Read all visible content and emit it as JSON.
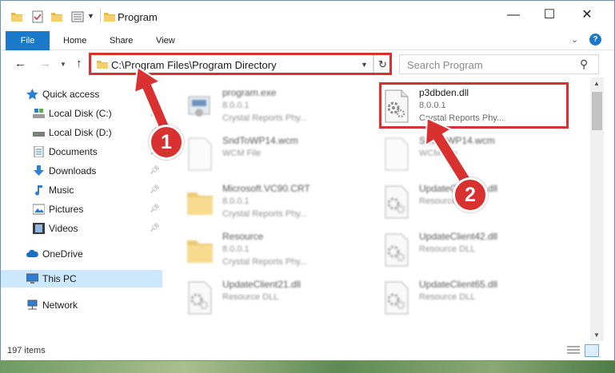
{
  "window": {
    "title": "Program",
    "controls": {
      "minimize": "—",
      "maximize": "☐",
      "close": "✕"
    }
  },
  "ribbon": {
    "tabs": [
      {
        "label": "File"
      },
      {
        "label": "Home"
      },
      {
        "label": "Share"
      },
      {
        "label": "View"
      }
    ],
    "help": "?"
  },
  "navigation": {
    "back": "←",
    "forward": "→",
    "history": "⌄",
    "up": "↑",
    "address": "C:\\Program Files\\Program Directory",
    "refresh": "↻",
    "search_placeholder": "Search Program"
  },
  "sidebar": {
    "items": [
      {
        "label": "Quick access",
        "icon": "star-icon"
      },
      {
        "label": "Local Disk (C:)",
        "icon": "drive-c-icon",
        "pinned": true
      },
      {
        "label": "Local Disk (D:)",
        "icon": "drive-icon",
        "pinned": true
      },
      {
        "label": "Documents",
        "icon": "documents-icon",
        "pinned": true
      },
      {
        "label": "Downloads",
        "icon": "download-icon",
        "pinned": true
      },
      {
        "label": "Music",
        "icon": "music-icon",
        "pinned": true
      },
      {
        "label": "Pictures",
        "icon": "pictures-icon",
        "pinned": true
      },
      {
        "label": "Videos",
        "icon": "videos-icon",
        "pinned": true
      },
      {
        "label": "OneDrive",
        "icon": "cloud-icon"
      },
      {
        "label": "This PC",
        "icon": "computer-icon",
        "selected": true
      },
      {
        "label": "Network",
        "icon": "network-icon"
      }
    ]
  },
  "files": [
    {
      "name": "program.exe",
      "line2": "8.0.0.1",
      "line3": "Crystal Reports Phy...",
      "icon": "exe-icon",
      "blurred": true
    },
    {
      "name": "p3dbden.dll",
      "line2": "8.0.0.1",
      "line3": "Crystal Reports Phy...",
      "icon": "dll-gear-icon",
      "blurred": false
    },
    {
      "name": "SndToWP14.wcm",
      "line2": "WCM File",
      "line3": "",
      "icon": "blank-file-icon",
      "blurred": true
    },
    {
      "name": "SndToWP14.wcm",
      "line2": "WCM File",
      "line3": "",
      "icon": "blank-file-icon",
      "blurred": true
    },
    {
      "name": "Microsoft.VC90.CRT",
      "line2": "8.0.0.1",
      "line3": "Crystal Reports Phy...",
      "icon": "folder-icon",
      "blurred": true
    },
    {
      "name": "UpdateClient39.dll",
      "line2": "Resource DLL",
      "line3": "",
      "icon": "dll-gear-icon",
      "blurred": true
    },
    {
      "name": "Resource",
      "line2": "8.0.0.1",
      "line3": "Crystal Reports Phy...",
      "icon": "folder-icon",
      "blurred": true
    },
    {
      "name": "UpdateClient42.dll",
      "line2": "Resource DLL",
      "line3": "",
      "icon": "dll-gear-icon",
      "blurred": true
    },
    {
      "name": "UpdateClient21.dll",
      "line2": "Resource DLL",
      "line3": "",
      "icon": "dll-gear-icon",
      "blurred": true
    },
    {
      "name": "UpdateClient65.dll",
      "line2": "Resource DLL",
      "line3": "",
      "icon": "dll-gear-icon",
      "blurred": true
    }
  ],
  "status": {
    "item_count": "197 items"
  },
  "annotations": {
    "badge1": "1",
    "badge2": "2",
    "color": "#d8312f"
  },
  "colors": {
    "accent": "#1979ca",
    "selection": "#cce8ff",
    "annotation": "#d8312f"
  }
}
